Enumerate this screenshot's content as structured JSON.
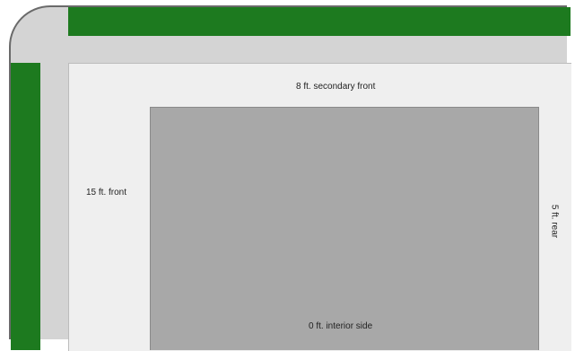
{
  "setbacks": {
    "secondary_front": "8 ft. secondary front",
    "front": "15 ft. front",
    "rear": "5 ft. rear",
    "interior_side": "0 ft. interior side"
  },
  "colors": {
    "right_of_way_green": "#1d7a1f",
    "sidewalk_gray": "#d4d4d4",
    "lot_light": "#efefef",
    "building_gray": "#a8a8a8"
  }
}
